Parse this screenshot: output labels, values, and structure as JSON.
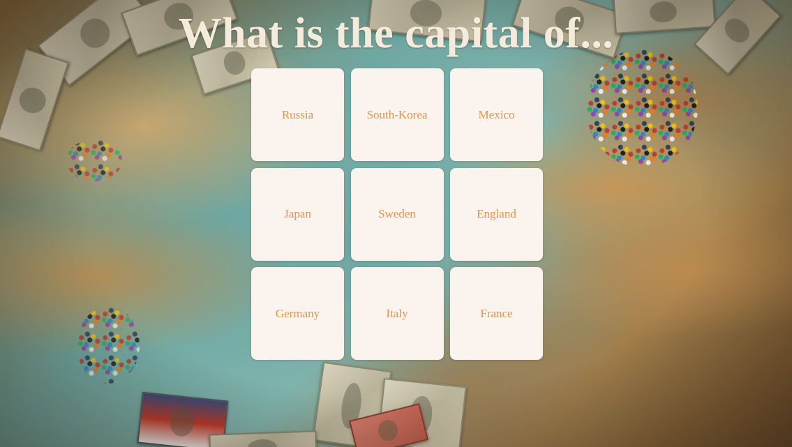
{
  "title": "What is the capital of...",
  "colors": {
    "card_background": "#fbf3ed",
    "card_text": "#e0954a",
    "title_text": "#f4ebdc"
  },
  "cards": [
    {
      "label": "Russia"
    },
    {
      "label": "South-Korea"
    },
    {
      "label": "Mexico"
    },
    {
      "label": "Japan"
    },
    {
      "label": "Sweden"
    },
    {
      "label": "England"
    },
    {
      "label": "Germany"
    },
    {
      "label": "Italy"
    },
    {
      "label": "France"
    }
  ]
}
